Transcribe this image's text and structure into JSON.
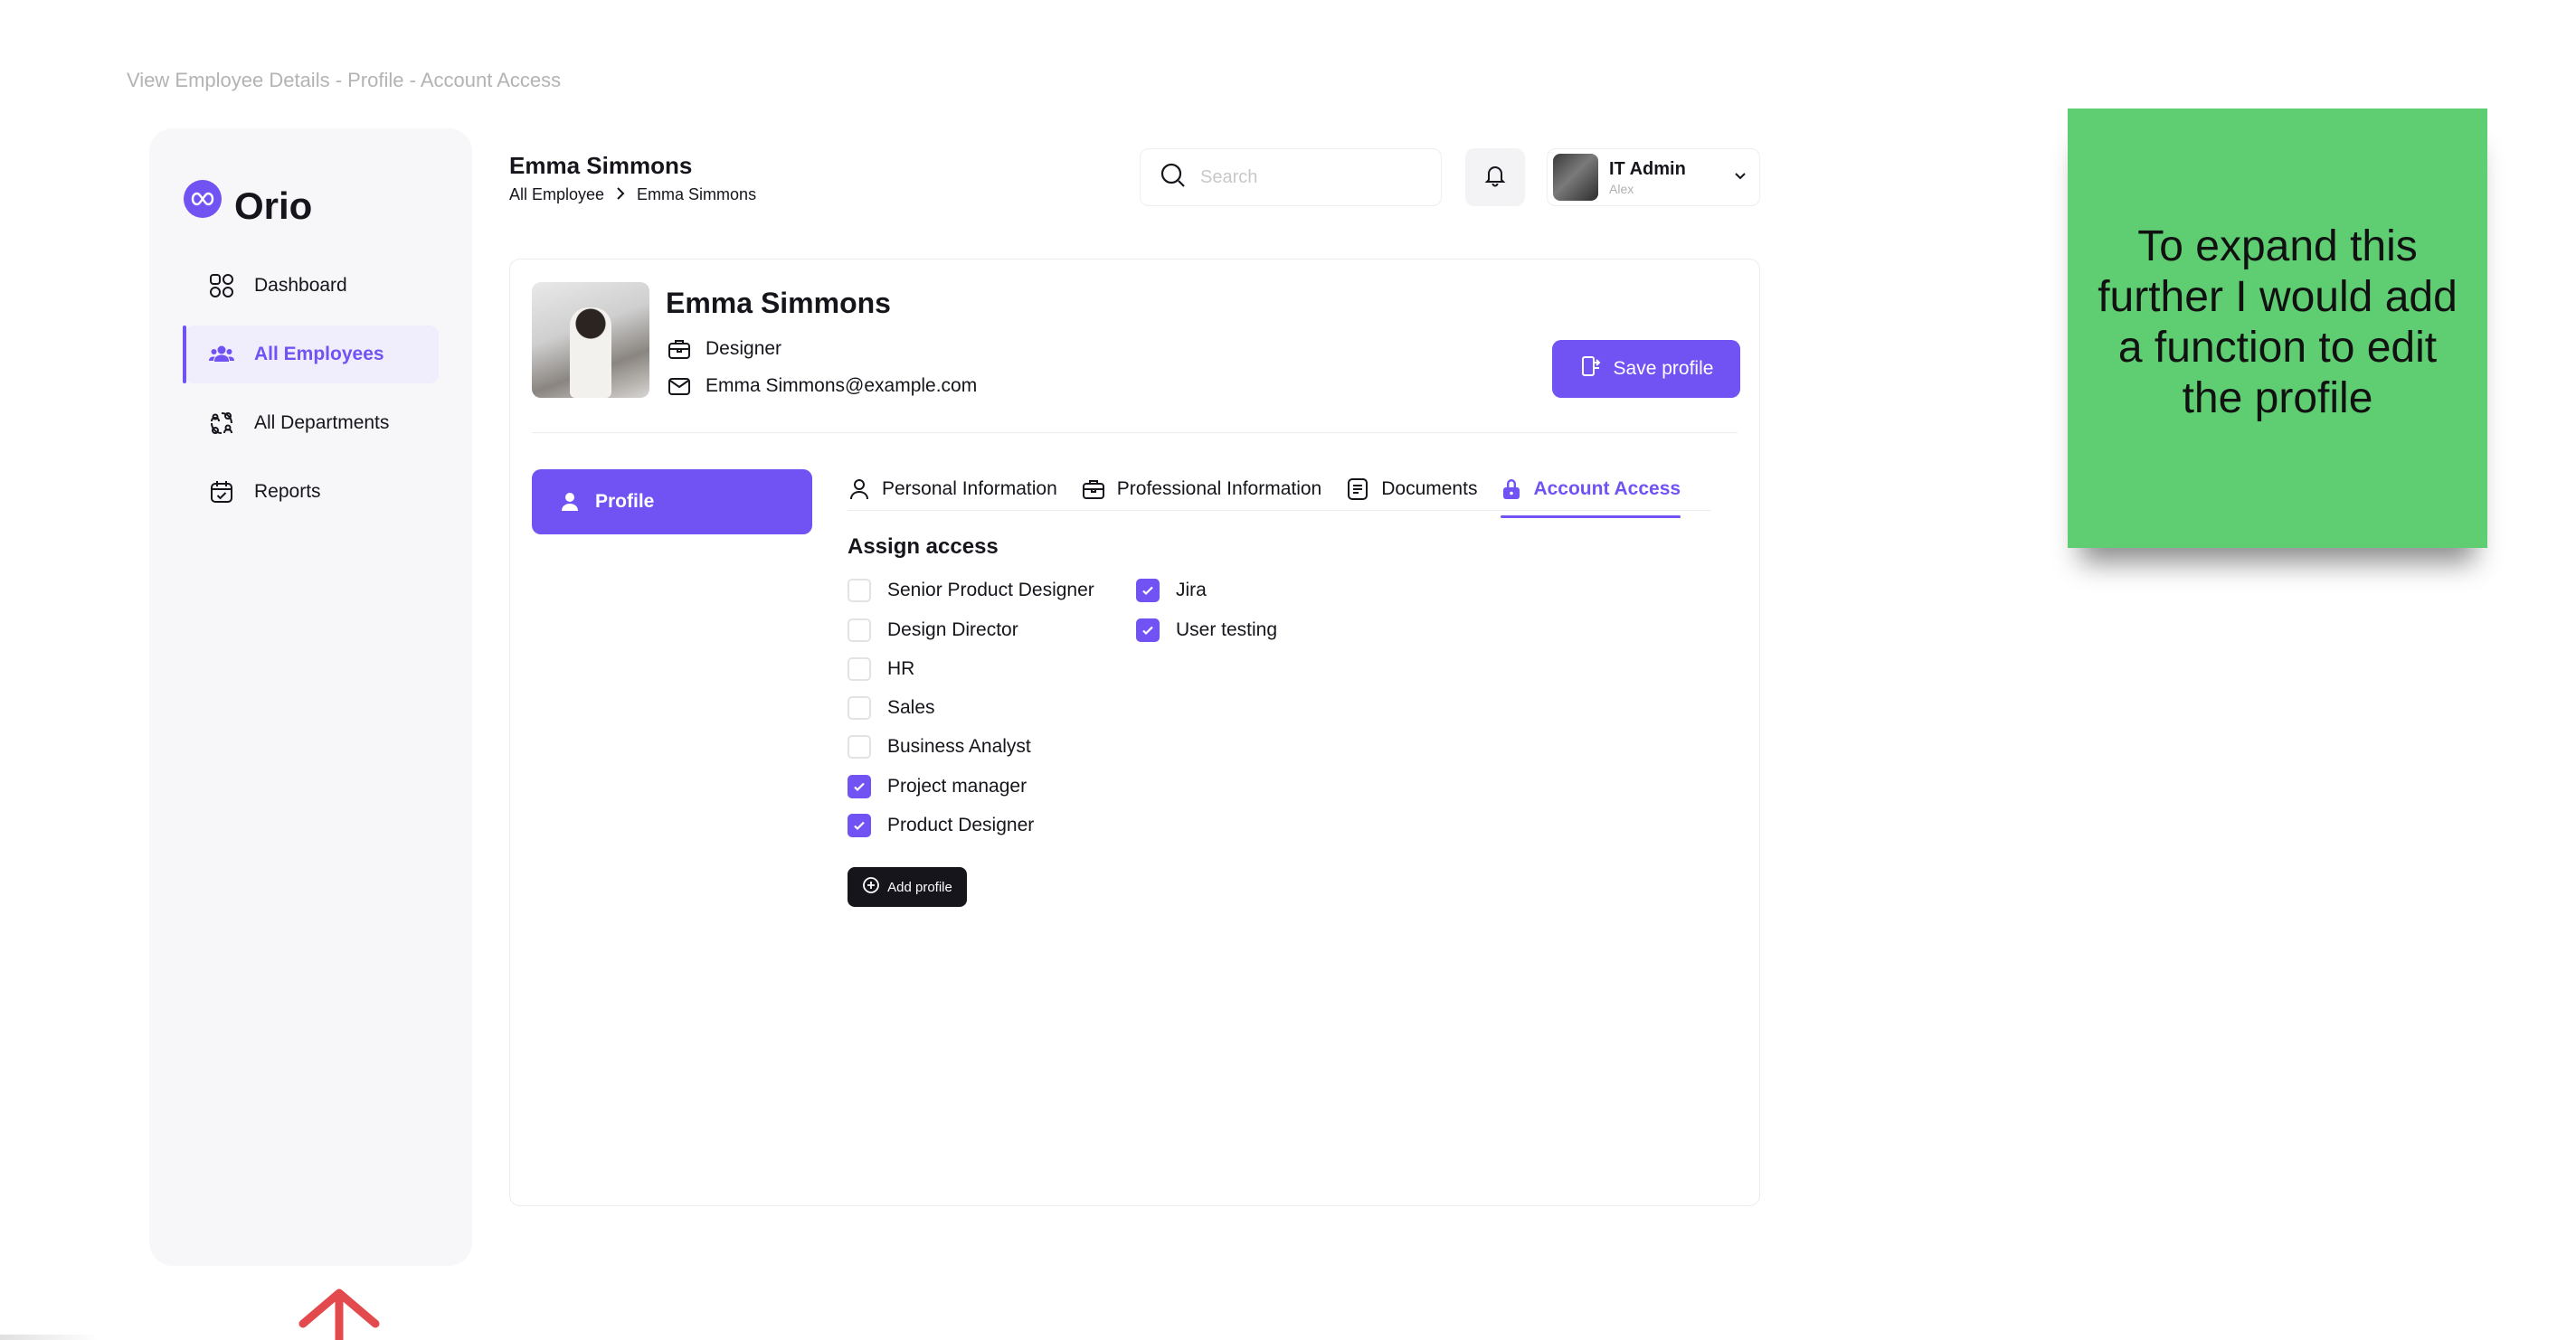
{
  "frame_label": "View Employee Details - Profile - Account Access",
  "app": {
    "name": "Orio",
    "accent": "#7152f3"
  },
  "sidebar": {
    "items": [
      {
        "label": "Dashboard",
        "icon": "grid-icon",
        "active": false
      },
      {
        "label": "All Employees",
        "icon": "users-icon",
        "active": true
      },
      {
        "label": "All Departments",
        "icon": "departments-icon",
        "active": false
      },
      {
        "label": "Reports",
        "icon": "calendar-check-icon",
        "active": false
      }
    ]
  },
  "header": {
    "title": "Emma Simmons",
    "breadcrumb": [
      "All Employee",
      "Emma Simmons"
    ],
    "search_placeholder": "Search",
    "user": {
      "name": "IT Admin",
      "subtitle": "Alex"
    }
  },
  "profile": {
    "name": "Emma Simmons",
    "role": "Designer",
    "email": "Emma Simmons@example.com",
    "save_label": "Save profile"
  },
  "side_tab": {
    "label": "Profile"
  },
  "tabs": [
    {
      "label": "Personal Information",
      "icon": "person-icon",
      "active": false
    },
    {
      "label": "Professional Information",
      "icon": "briefcase-icon",
      "active": false
    },
    {
      "label": "Documents",
      "icon": "document-icon",
      "active": false
    },
    {
      "label": "Account Access",
      "icon": "lock-icon",
      "active": true
    }
  ],
  "access": {
    "title": "Assign access",
    "left": [
      {
        "label": "Senior Product Designer",
        "checked": false
      },
      {
        "label": "Design Director",
        "checked": false
      },
      {
        "label": "HR",
        "checked": false
      },
      {
        "label": "Sales",
        "checked": false
      },
      {
        "label": "Business Analyst",
        "checked": false
      },
      {
        "label": "Project manager",
        "checked": true
      },
      {
        "label": "Product Designer",
        "checked": true
      }
    ],
    "right": [
      {
        "label": "Jira",
        "checked": true
      },
      {
        "label": "User testing",
        "checked": true
      }
    ],
    "add_label": "Add profile"
  },
  "sticky_note": {
    "text": "To expand this further I would add a function to edit the profile",
    "color": "#5fcd72"
  }
}
